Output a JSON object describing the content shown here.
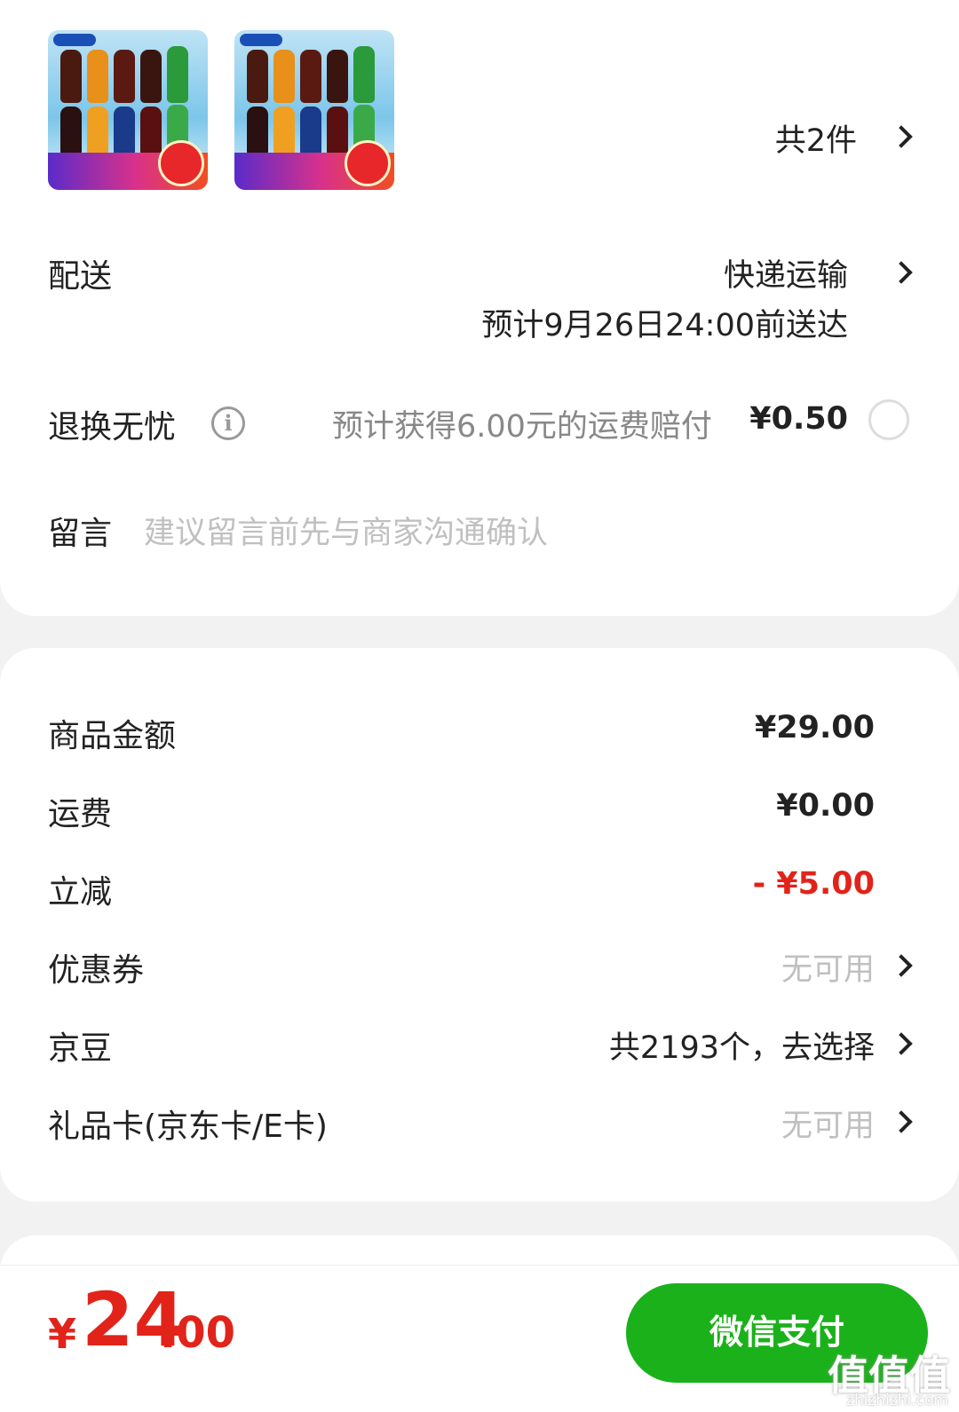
{
  "items": {
    "count_label": "共2件",
    "thumbnails": [
      {
        "image": "pepsi-bottles-image"
      },
      {
        "image": "pepsi-bottles-image"
      }
    ]
  },
  "delivery": {
    "label": "配送",
    "method": "快递运输",
    "eta": "预计9月26日24:00前送达"
  },
  "return_worry_free": {
    "label": "退换无忧",
    "info_icon": "info-icon",
    "note": "预计获得6.00元的运费赔付",
    "price": "¥0.50"
  },
  "message": {
    "label": "留言",
    "placeholder": "建议留言前先与商家沟通确认"
  },
  "summary": {
    "goods_amount_label": "商品金额",
    "goods_amount": "¥29.00",
    "shipping_label": "运费",
    "shipping": "¥0.00",
    "discount_label": "立减",
    "discount": "- ¥5.00",
    "coupon_label": "优惠券",
    "coupon": "无可用",
    "jingdou_label": "京豆",
    "jingdou": "共2193个，去选择",
    "giftcard_label": "礼品卡(京东卡/E卡)",
    "giftcard": "无可用"
  },
  "footer": {
    "currency": "¥",
    "total_int": "24",
    "total_dec": ".00",
    "pay_label": "微信支付"
  },
  "watermark": {
    "text": "值值值",
    "sub": "zhizhizhi.com"
  },
  "colors": {
    "accent_green": "#1bb11b",
    "price_red": "#e2231a",
    "muted": "#c0c0c0"
  }
}
